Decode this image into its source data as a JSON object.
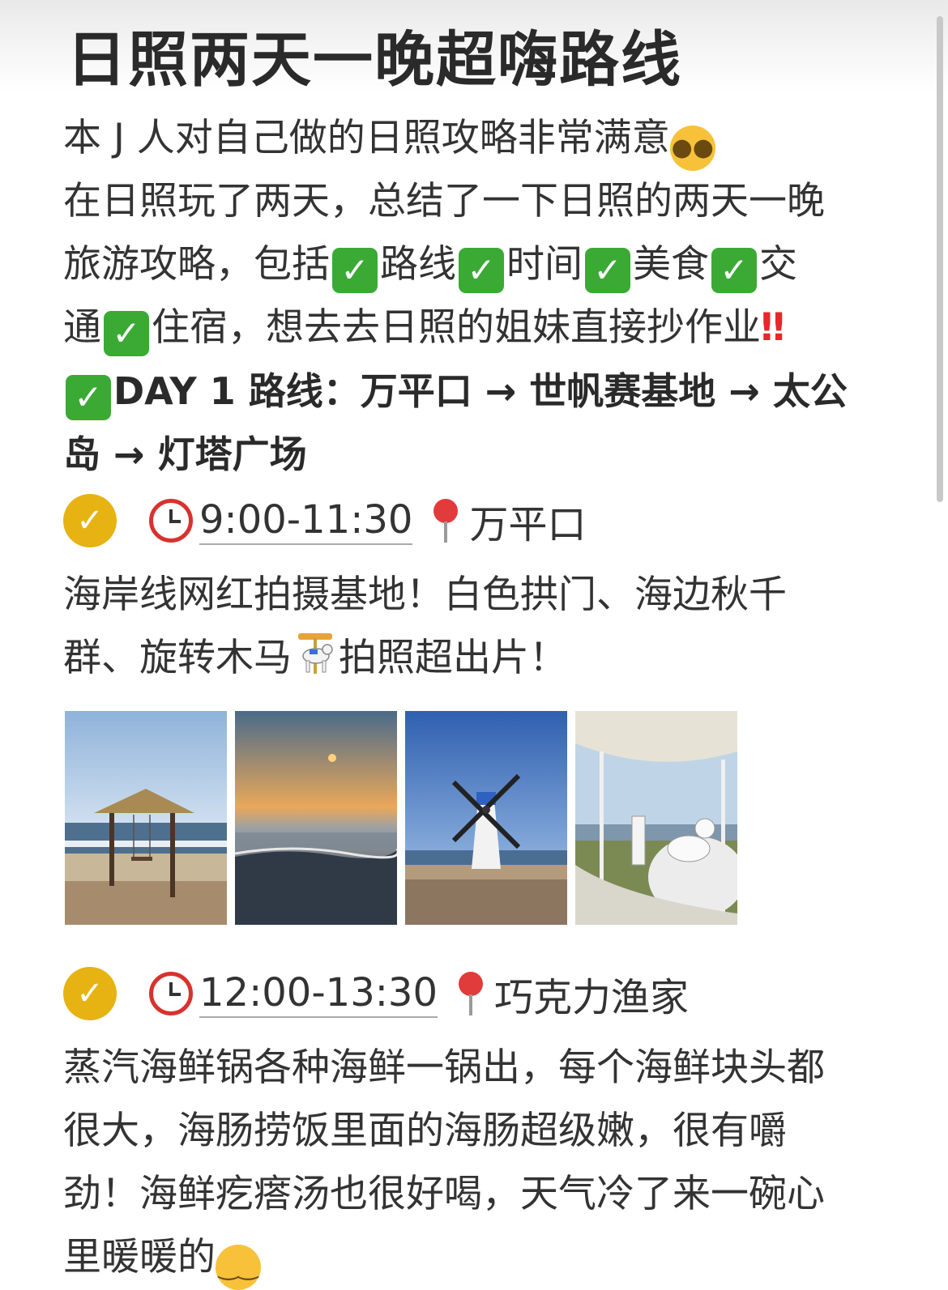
{
  "title": "日照两天一晚超嗨路线",
  "intro": {
    "line1": "本 J 人对自己做的日照攻略非常满意",
    "line2": "在日照玩了两天，总结了一下日照的两天一晚",
    "line3_a": "旅游攻略，包括",
    "line3_b": "路线",
    "line3_c": "时间",
    "line3_d": "美食",
    "line3_e": "交",
    "line4_a": "通",
    "line4_b": "住宿，想去去日照的姐妹直接抄作业",
    "bangs": "‼"
  },
  "day1": {
    "line1": "DAY 1 路线：万平口 → 世帆赛基地 → 太公",
    "line2": "岛 → 灯塔广场"
  },
  "stop1": {
    "time": "9:00-11:30",
    "place": "万平口",
    "desc1": "海岸线网红拍摄基地！白色拱门、海边秋千",
    "desc2a": "群、旋转木马",
    "desc2b": "拍照超出片！"
  },
  "stop2": {
    "time": "12:00-13:30",
    "place": "巧克力渔家",
    "desc1": "蒸汽海鲜锅各种海鲜一锅出，每个海鲜块头都",
    "desc2": "很大，海肠捞饭里面的海肠超级嫩，很有嚼",
    "desc3": "劲！海鲜疙瘩汤也很好喝，天气冷了来一碗心",
    "desc4": "里暖暖的"
  },
  "colors": {
    "check_green": "#3aaa35",
    "yellow_check": "#e6b312",
    "alarm_red": "#d8322f"
  },
  "icons": {
    "party": "partying-face-icon",
    "check": "check-mark-button-icon",
    "alarm": "alarm-clock-icon",
    "pin": "round-pushpin-icon",
    "carousel": "carousel-horse-icon",
    "smile": "relieved-face-icon"
  }
}
